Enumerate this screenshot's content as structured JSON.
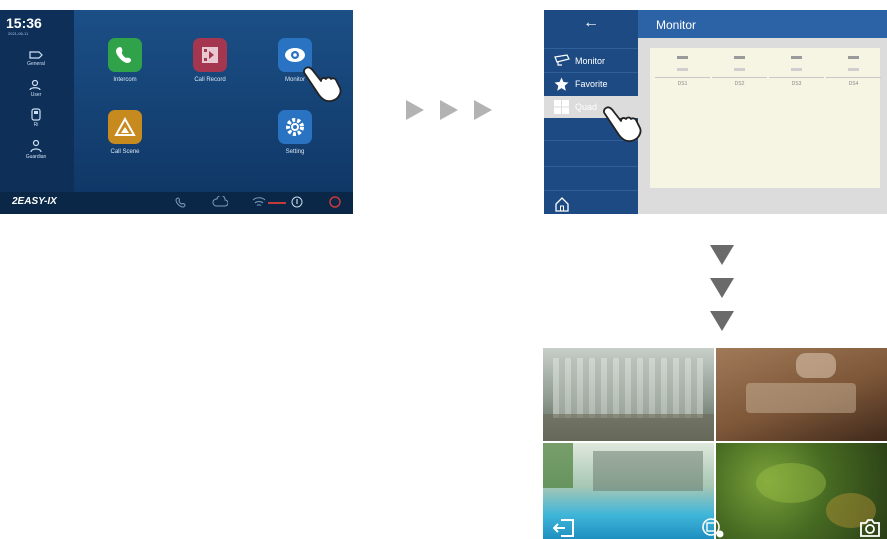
{
  "home": {
    "time": "15:36",
    "date": "2021-06-11",
    "sidebar": [
      {
        "label": "General",
        "icon": "general-icon"
      },
      {
        "label": "User",
        "icon": "user-icon"
      },
      {
        "label": "Ri",
        "icon": "ring-icon"
      },
      {
        "label": "Guardian",
        "icon": "guardian-icon"
      }
    ],
    "apps": [
      {
        "label": "Intercom",
        "icon": "phone-icon",
        "color": "#2fa24a"
      },
      {
        "label": "Call Record",
        "icon": "call-record-icon",
        "color": "#a5364f"
      },
      {
        "label": "Monitor",
        "icon": "eye-icon",
        "color": "#2a73c2"
      },
      {
        "label": "Call Scene",
        "icon": "scene-icon",
        "color": "#c78a1e"
      },
      {
        "label": "Setting",
        "icon": "gear-icon",
        "color": "#2a73c2"
      }
    ],
    "brand": "2EASY-IX"
  },
  "monitor": {
    "back": "←",
    "title": "Monitor",
    "menu": [
      {
        "label": "Monitor",
        "icon": "camera-icon"
      },
      {
        "label": "Favorite",
        "icon": "star-icon"
      },
      {
        "label": "Quad",
        "icon": "quad-grid-icon"
      }
    ],
    "cameras": [
      "DS1",
      "DS2",
      "DS3",
      "DS4"
    ]
  },
  "quad": {
    "views": [
      "camera-view-1",
      "camera-view-2",
      "camera-view-3",
      "camera-view-4"
    ]
  },
  "colors": {
    "home_bg": "#1b4f86",
    "monitor_header": "#2c63a6",
    "panel_bg": "#f6f4e2"
  }
}
